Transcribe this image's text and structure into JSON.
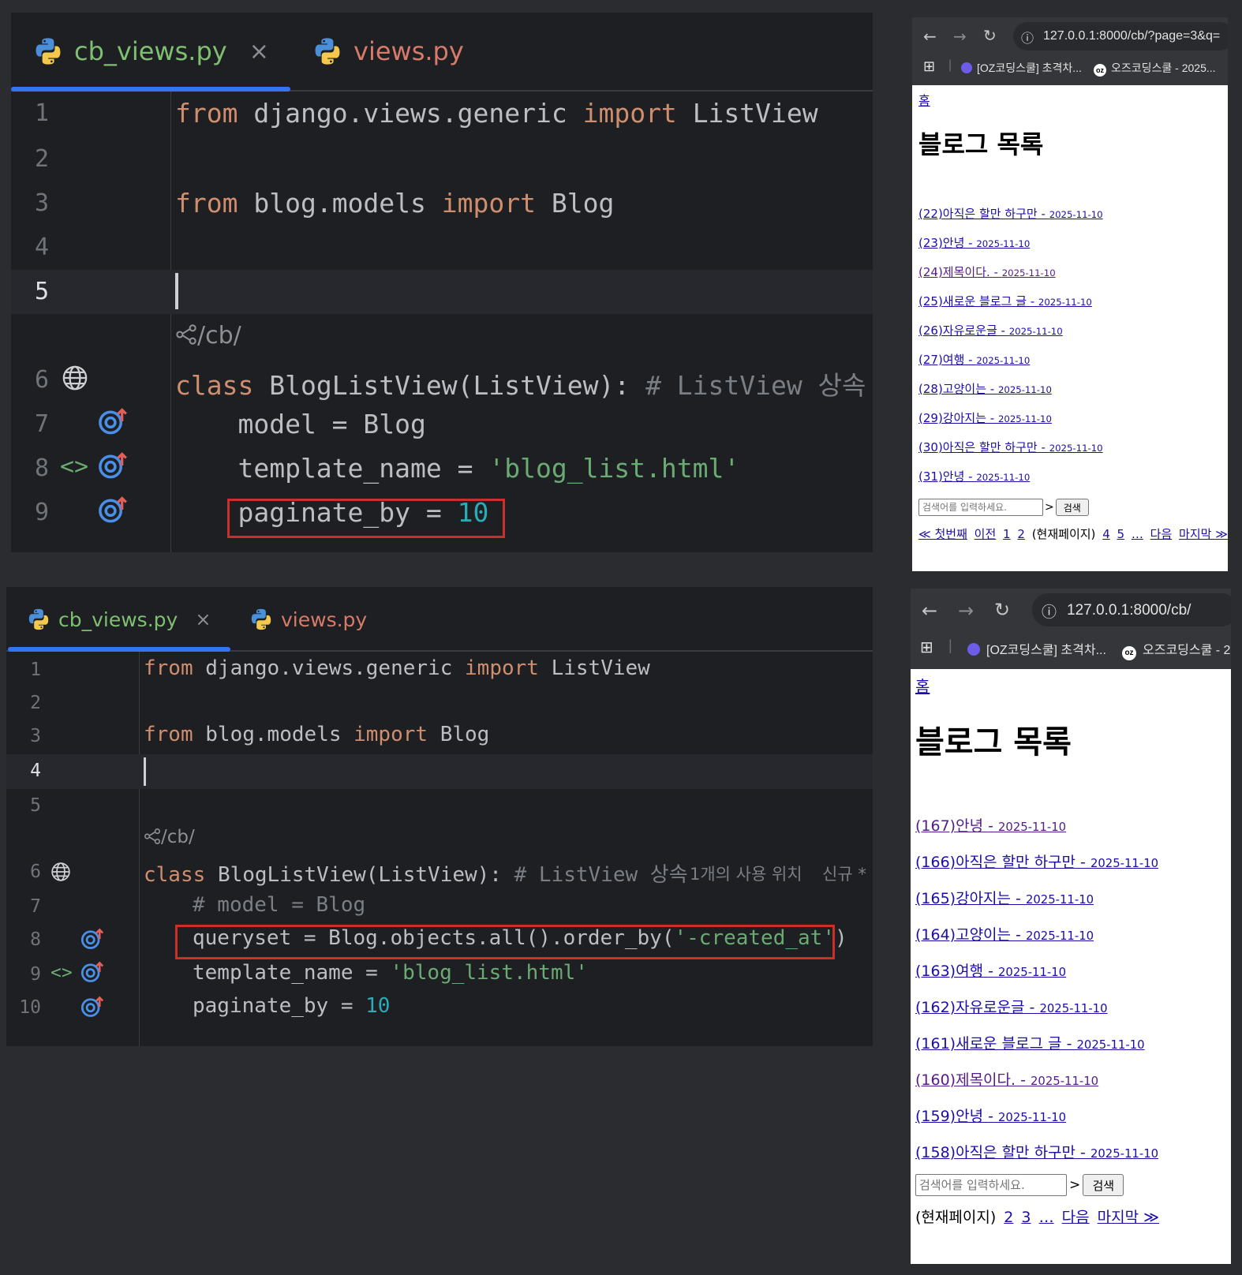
{
  "ide_top": {
    "tabs": [
      {
        "label": "cb_views.py",
        "active": true,
        "close": "×"
      },
      {
        "label": "views.py",
        "active": false
      }
    ],
    "lines": [
      {
        "num": "1",
        "tokens": [
          [
            "kw",
            "from"
          ],
          [
            "",
            "django.views.generic"
          ],
          [
            "kw",
            "import"
          ],
          [
            "",
            "ListView"
          ]
        ]
      },
      {
        "num": "2",
        "tokens": []
      },
      {
        "num": "3",
        "tokens": [
          [
            "kw",
            "from"
          ],
          [
            "",
            "blog.models"
          ],
          [
            "kw",
            "import"
          ],
          [
            "",
            "Blog"
          ]
        ]
      },
      {
        "num": "4",
        "tokens": []
      },
      {
        "num": "5",
        "tokens": []
      },
      {
        "num": "6",
        "tokens": [
          [
            "kw",
            "class"
          ],
          [
            "",
            "BlogListView(ListView):"
          ],
          [
            "cmt",
            "# ListView 상속"
          ]
        ]
      },
      {
        "num": "7",
        "tokens": [
          [
            "",
            "    model = Blog"
          ]
        ]
      },
      {
        "num": "8",
        "tokens": [
          [
            "",
            "    template_name = "
          ],
          [
            "str",
            "'blog_list.html'"
          ]
        ]
      },
      {
        "num": "9",
        "tokens": [
          [
            "",
            "    paginate_by = "
          ],
          [
            "num",
            "10"
          ]
        ]
      }
    ],
    "url_hint": "/cb/"
  },
  "ide_bottom": {
    "tabs": [
      {
        "label": "cb_views.py",
        "active": true,
        "close": "×"
      },
      {
        "label": "views.py",
        "active": false
      }
    ],
    "url_hint": "/cb/",
    "inlay_usage": "1개의 사용 위치",
    "inlay_new": "신규 *",
    "lines": [
      {
        "num": "1"
      },
      {
        "num": "2"
      },
      {
        "num": "3"
      },
      {
        "num": "4"
      },
      {
        "num": "5"
      },
      {
        "num": "6"
      },
      {
        "num": "7"
      },
      {
        "num": "8"
      },
      {
        "num": "9"
      },
      {
        "num": "10"
      }
    ],
    "code": {
      "l1": [
        "from",
        "django.views.generic",
        "import",
        "ListView"
      ],
      "l3": [
        "from",
        "blog.models",
        "import",
        "Blog"
      ],
      "l6": [
        "class",
        "BlogListView(ListView):",
        "# ListView 상속"
      ],
      "l7": "# model = Blog",
      "l8": [
        "queryset = Blog.objects.all().order_by(",
        "'-created_at'",
        ")"
      ],
      "l9": [
        "template_name = ",
        "'blog_list.html'"
      ],
      "l10": [
        "paginate_by = ",
        "10"
      ]
    }
  },
  "browser_top": {
    "url": "127.0.0.1:8000/cb/?page=3&q=",
    "bookmarks": [
      "[OZ코딩스쿨] 초격차...",
      "오즈코딩스쿨 - 2025..."
    ],
    "bookmark_badge": "oz",
    "home": "홈",
    "title": "블로그 목록",
    "posts": [
      {
        "title": "(22)아직은 할만 하구만 - ",
        "date": "2025-11-10"
      },
      {
        "title": "(23)안녕 - ",
        "date": "2025-11-10"
      },
      {
        "title": "(24)제목이다. - ",
        "date": "2025-11-10"
      },
      {
        "title": "(25)새로운 블로그 글 - ",
        "date": "2025-11-10"
      },
      {
        "title": "(26)자유로운글 - ",
        "date": "2025-11-10"
      },
      {
        "title": "(27)여행 - ",
        "date": "2025-11-10"
      },
      {
        "title": "(28)고양이는 - ",
        "date": "2025-11-10"
      },
      {
        "title": "(29)강아지는 - ",
        "date": "2025-11-10"
      },
      {
        "title": "(30)아직은 할만 하구만 - ",
        "date": "2025-11-10"
      },
      {
        "title": "(31)안녕 - ",
        "date": "2025-11-10"
      }
    ],
    "search_placeholder": "검색어를 입력하세요.",
    "search_arrow": ">",
    "search_button": "검색",
    "pager": {
      "first": "≪ 첫번째",
      "prev": "이전",
      "p1": "1",
      "p2": "2",
      "current": "(현재페이지)",
      "p4": "4",
      "p5": "5",
      "ellipsis": "…",
      "next": "다음",
      "last": "마지막 ≫"
    }
  },
  "browser_bottom": {
    "url": "127.0.0.1:8000/cb/",
    "bookmarks": [
      "[OZ코딩스쿨] 초격차...",
      "오즈코딩스쿨 - 2"
    ],
    "bookmark_badge": "oz",
    "home": "홈",
    "title": "블로그 목록",
    "posts": [
      {
        "title": "(167)안녕 - ",
        "date": "2025-11-10"
      },
      {
        "title": "(166)아직은 할만 하구만 - ",
        "date": "2025-11-10"
      },
      {
        "title": "(165)강아지는 - ",
        "date": "2025-11-10"
      },
      {
        "title": "(164)고양이는 - ",
        "date": "2025-11-10"
      },
      {
        "title": "(163)여행 - ",
        "date": "2025-11-10"
      },
      {
        "title": "(162)자유로운글 - ",
        "date": "2025-11-10"
      },
      {
        "title": "(161)새로운 블로그 글 - ",
        "date": "2025-11-10"
      },
      {
        "title": "(160)제목이다. - ",
        "date": "2025-11-10"
      },
      {
        "title": "(159)안녕 - ",
        "date": "2025-11-10"
      },
      {
        "title": "(158)아직은 할만 하구만 - ",
        "date": "2025-11-10"
      }
    ],
    "search_placeholder": "검색어를 입력하세요.",
    "search_arrow": ">",
    "search_button": "검색",
    "pager": {
      "current": "(현재페이지)",
      "p2": "2",
      "p3": "3",
      "ellipsis": "…",
      "next": "다음",
      "last": "마지막 ≫"
    }
  },
  "colors": {
    "keyword": "#cf8e6d",
    "string": "#6aab73",
    "number": "#2aacb8",
    "comment": "#7a7e85",
    "highlight_box": "#c9302c",
    "tab_accent": "#3574f0"
  }
}
